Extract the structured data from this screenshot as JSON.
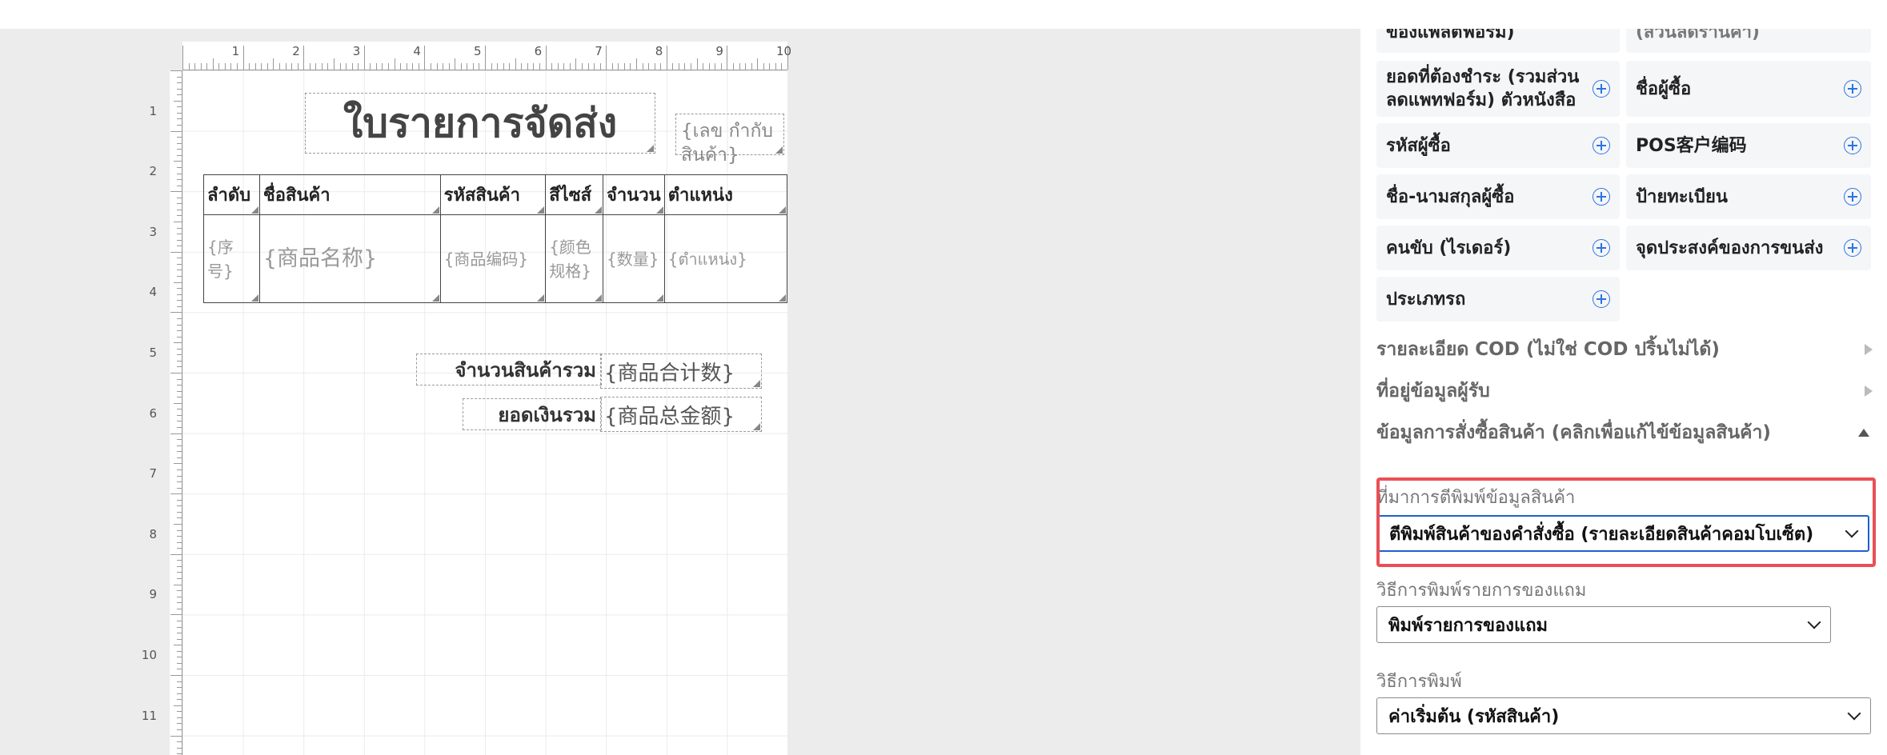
{
  "ruler": {
    "top_numbers": [
      "1",
      "2",
      "3",
      "4",
      "5",
      "6",
      "7",
      "8",
      "9",
      "10"
    ],
    "left_numbers": [
      "1",
      "2",
      "3",
      "4",
      "5",
      "6",
      "7",
      "8",
      "9",
      "10",
      "11"
    ]
  },
  "canvas": {
    "title": "ใบรายการจัดส่ง",
    "tracking_placeholder": "{เลข กำกับ สินค้า}",
    "table_headers": [
      "ลำดับ",
      "ชื่อสินค้า",
      "รหัสสินค้า",
      "สีไซส์",
      "จำนวน",
      "ตำแหน่ง"
    ],
    "table_row": [
      "{序号}",
      "{商品名称}",
      "{商品编码}",
      "{颜色规格}",
      "{数量}",
      "{ตำแหน่ง}"
    ],
    "total_qty_label": "จำนวนสินค้ารวม",
    "total_qty_value": "{商品合计数}",
    "total_amount_label": "ยอดเงินรวม",
    "total_amount_value": "{商品总金额}"
  },
  "panel": {
    "chips": [
      {
        "label": "ของแพลตฟอร์ม)"
      },
      {
        "label": "(ส่วนลดร้านค้า)"
      },
      {
        "label": "ยอดที่ต้องชำระ (รวมส่วนลดแพทฟอร์ม) ตัวหนังสือ"
      },
      {
        "label": "ชื่อผู้ซื้อ"
      },
      {
        "label": "รหัสผู้ซื้อ"
      },
      {
        "label": "POS客户编码"
      },
      {
        "label": "ชื่อ-นามสกุลผู้ซื้อ"
      },
      {
        "label": "ป้ายทะเบียน"
      },
      {
        "label": "คนขับ (ไรเดอร์)"
      },
      {
        "label": "จุดประสงค์ของการขนส่ง"
      },
      {
        "label": "ประเภทรถ"
      }
    ],
    "sections": [
      {
        "label": "รายละเอียด COD (ไม่ใช่ COD ปริ้นไม่ได้)"
      },
      {
        "label": "ที่อยู่ข้อมูลผู้รับ"
      },
      {
        "label": "ข้อมูลการสั่งซื้อสินค้า (คลิกเพื่อแก้ไข้ข้อมูลสินค้า)"
      }
    ],
    "fields": [
      {
        "label": "ที่มาการตีพิมพ์ข้อมูลสินค้า",
        "value": "ตีพิมพ์สินค้าของคำสั่งซื้อ (รายละเอียดสินค้าคอมโบเซ็ต)"
      },
      {
        "label": "วิธีการพิมพ์รายการของแถม",
        "value": "พิมพ์รายการของแถม"
      },
      {
        "label": "วิธีการพิมพ์",
        "value": "ค่าเริ่มต้น (รหัสสินค้า)"
      }
    ]
  },
  "colors": {
    "highlight": "#ea4f55",
    "accent": "#2b74e3"
  }
}
